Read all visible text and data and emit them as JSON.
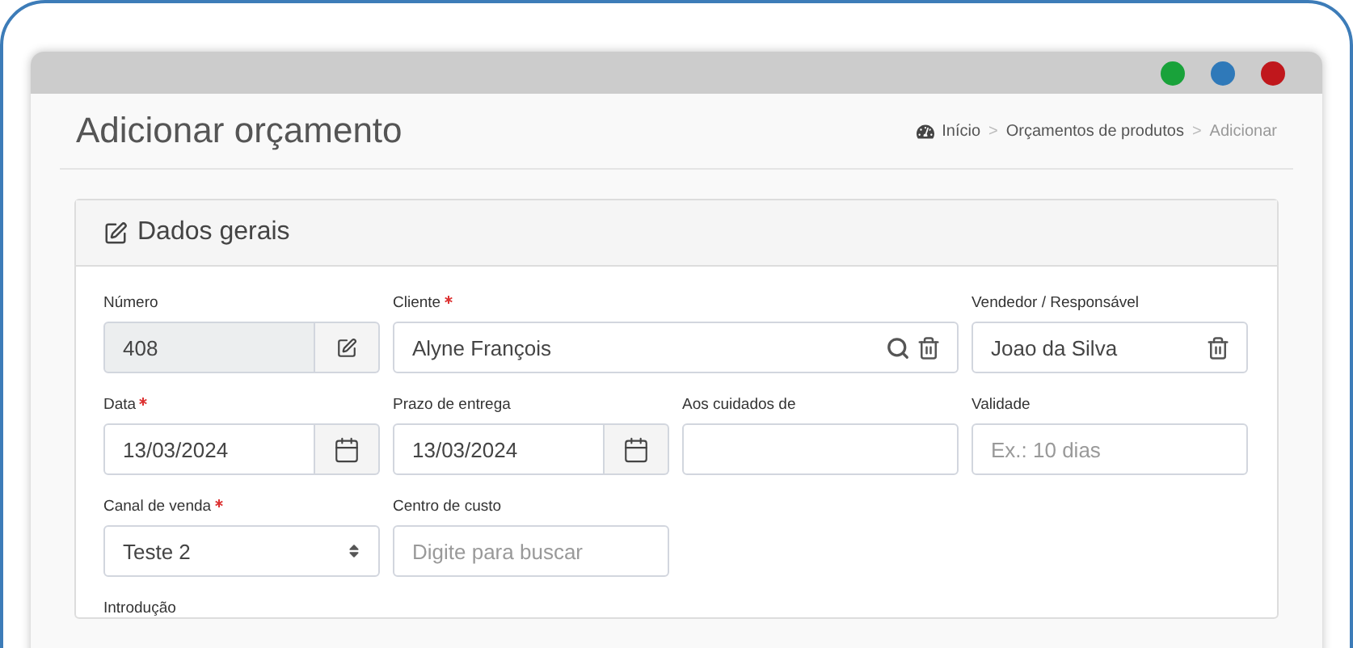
{
  "window": {
    "controls": [
      {
        "color": "#19a23a"
      },
      {
        "color": "#2f79b9"
      },
      {
        "color": "#c0171c"
      }
    ]
  },
  "page": {
    "title": "Adicionar orçamento"
  },
  "breadcrumb": [
    {
      "label": "Início",
      "kind": "home"
    },
    {
      "label": ">",
      "kind": "separator"
    },
    {
      "label": "Orçamentos de produtos",
      "kind": "link"
    },
    {
      "label": ">",
      "kind": "separator"
    },
    {
      "label": "Adicionar",
      "kind": "current"
    }
  ],
  "card": {
    "title": "Dados gerais"
  },
  "rows": [
    [
      {
        "label": "Número",
        "required": false,
        "kind": "addon-edit",
        "value": "408",
        "disabled": true
      },
      {
        "label": "Cliente",
        "required": true,
        "kind": "search-lookup",
        "value": "Alyne François",
        "disabled": false
      },
      {
        "label": "Vendedor / Responsável",
        "required": false,
        "kind": "lookup",
        "value": "Joao da Silva",
        "disabled": false
      }
    ],
    [
      {
        "label": "Data",
        "required": true,
        "kind": "date",
        "value": "13/03/2024",
        "disabled": false
      },
      {
        "label": "Prazo de entrega",
        "required": false,
        "kind": "date",
        "value": "13/03/2024",
        "disabled": false
      },
      {
        "label": "Aos cuidados de",
        "required": false,
        "kind": "text",
        "disabled": false
      },
      {
        "label": "Validade",
        "required": false,
        "kind": "text",
        "placeholder": "Ex.: 10 dias",
        "disabled": false
      }
    ],
    [
      {
        "label": "Canal de venda",
        "required": true,
        "kind": "select",
        "value": "Teste 2",
        "disabled": false
      },
      {
        "label": "Centro de custo",
        "required": false,
        "kind": "text",
        "placeholder": "Digite para buscar",
        "disabled": false
      }
    ],
    [
      {
        "label": "Introdução",
        "required": false,
        "kind": "label-only"
      }
    ]
  ]
}
